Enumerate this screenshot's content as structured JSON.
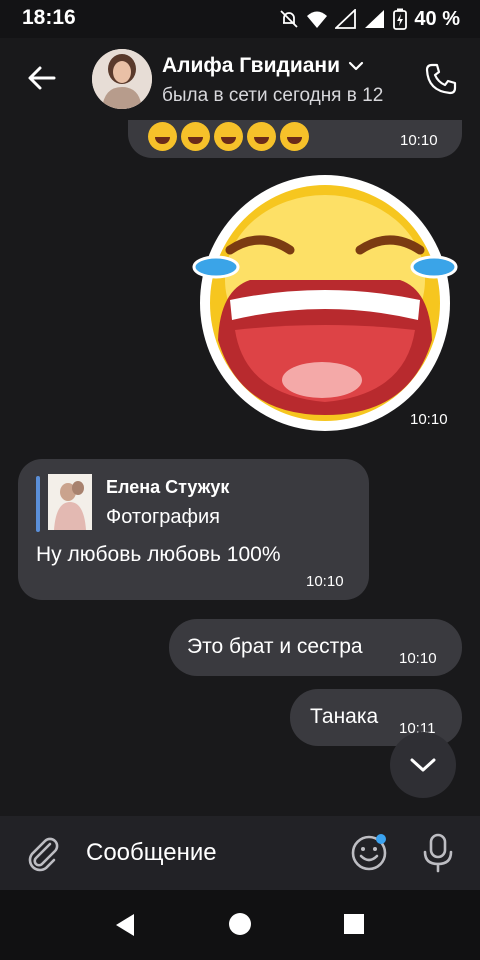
{
  "status_bar": {
    "time": "18:16",
    "battery": "40 %",
    "icons": [
      "bell-off-icon",
      "wifi-icon",
      "signal-icon",
      "battery-charging-icon"
    ]
  },
  "header": {
    "name": "Алифа Гвидиани",
    "subtitle": "была в сети сегодня в 12",
    "icons": [
      "back-arrow-icon",
      "chevron-down-icon",
      "phone-icon"
    ]
  },
  "messages": [
    {
      "type": "emoji",
      "time": "10:10"
    },
    {
      "type": "sticker",
      "time": "10:10"
    },
    {
      "type": "reply",
      "reply_author": "Елена Стужук",
      "reply_label": "Фотография",
      "text": "Ну любовь любовь 100%",
      "time": "10:10"
    },
    {
      "type": "text",
      "text": "Это брат и сестра",
      "time": "10:10"
    },
    {
      "type": "text",
      "text": "Танака",
      "time": "10:11"
    }
  ],
  "composer": {
    "placeholder": "Сообщение",
    "icons": [
      "paperclip-icon",
      "emoji-icon",
      "microphone-icon"
    ]
  },
  "nav": {
    "icons": [
      "nav-back-icon",
      "nav-home-icon",
      "nav-recents-icon"
    ]
  },
  "colors": {
    "background": "#19191b",
    "bubble": "#3a3a3f",
    "accent": "#5b8fd8"
  }
}
